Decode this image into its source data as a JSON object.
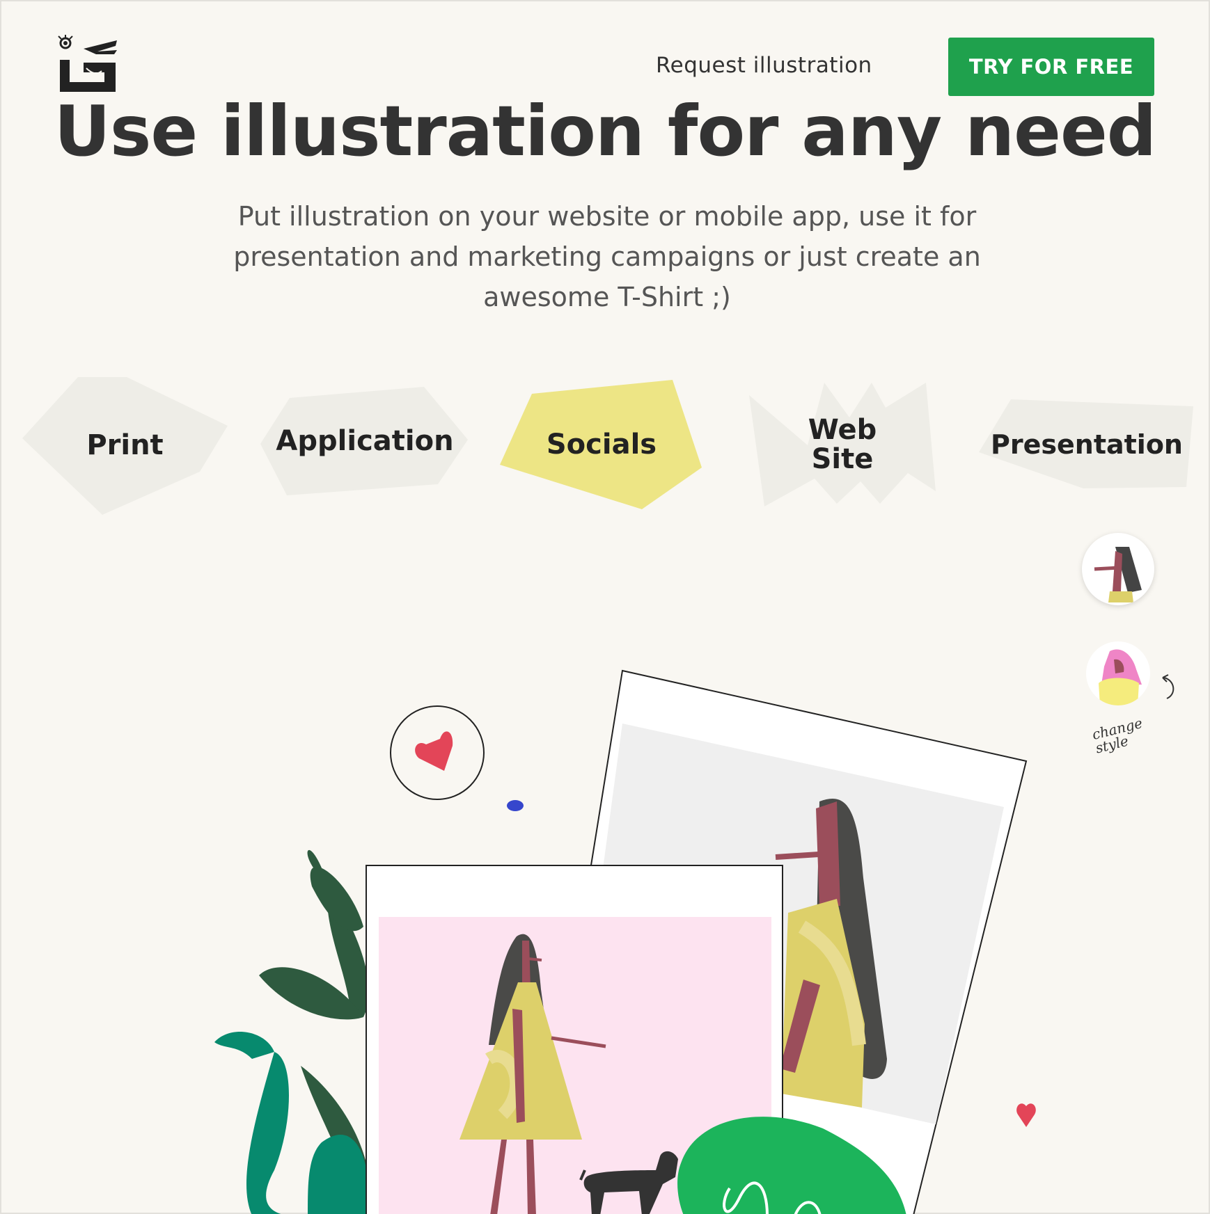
{
  "header": {
    "logo_icon": "hand-eye-logo-icon",
    "request_link": "Request illustration",
    "cta_button": "TRY FOR FREE",
    "cta_color": "#1fa14d"
  },
  "hero": {
    "headline": "Use illustration for any need",
    "subtitle": "Put illustration on your website or mobile app, use it for presentation and marketing campaigns or just create an awesome T-Shirt ;)"
  },
  "use_tabs": [
    {
      "label": "Print",
      "active": false
    },
    {
      "label": "Application",
      "active": false
    },
    {
      "label": "Socials",
      "active": true
    },
    {
      "label": "Web Site",
      "active": false
    },
    {
      "label": "Presentation",
      "active": false
    }
  ],
  "tab_colors": {
    "inactive": "#eeede7",
    "active": "#ede585"
  },
  "style_switcher": {
    "label": "change style",
    "options": [
      "style-1-avatar",
      "style-2-avatar"
    ]
  }
}
